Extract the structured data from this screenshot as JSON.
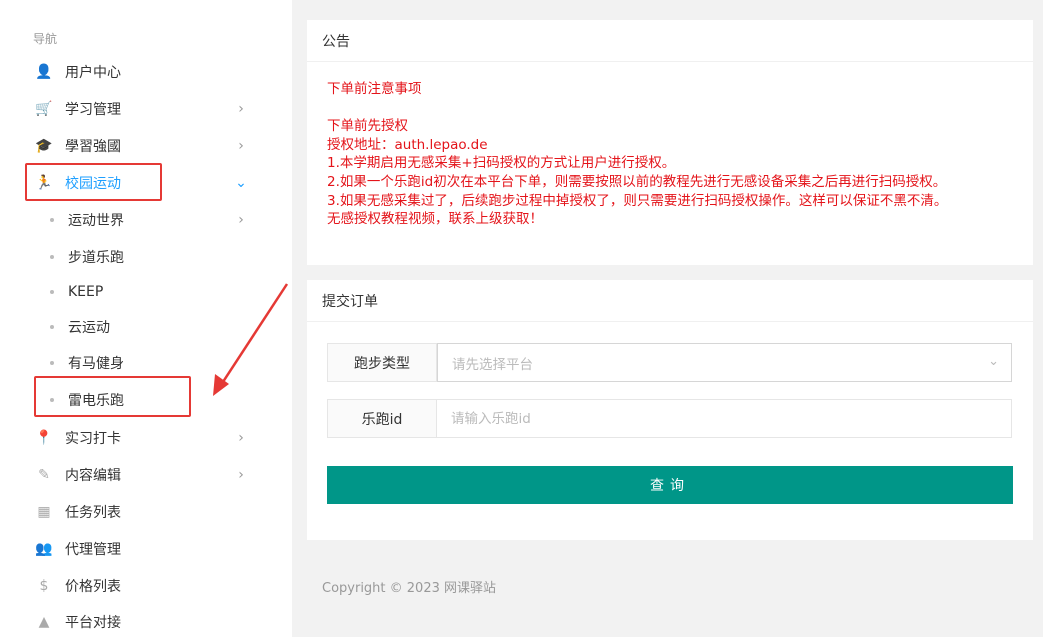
{
  "sidebar": {
    "caption": "导航",
    "items": [
      {
        "label": "用户中心",
        "icon": "user-icon",
        "glyph": "👤",
        "has_children": false
      },
      {
        "label": "学习管理",
        "icon": "cart-icon",
        "glyph": "🛒",
        "has_children": true
      },
      {
        "label": "學習強國",
        "icon": "graduation-cap-icon",
        "glyph": "🎓",
        "has_children": true
      },
      {
        "label": "校园运动",
        "icon": "running-icon",
        "glyph": "🏃",
        "has_children": true,
        "expanded": true,
        "active": true
      }
    ],
    "sub_items": [
      {
        "label": "运动世界",
        "has_children": true
      },
      {
        "label": "步道乐跑",
        "has_children": false
      },
      {
        "label": "KEEP",
        "has_children": false
      },
      {
        "label": "云运动",
        "has_children": false
      },
      {
        "label": "有马健身",
        "has_children": false
      },
      {
        "label": "雷电乐跑",
        "has_children": false
      }
    ],
    "items_after": [
      {
        "label": "实习打卡",
        "icon": "location-pin-icon",
        "glyph": "📍",
        "has_children": true
      },
      {
        "label": "内容编辑",
        "icon": "edit-icon",
        "glyph": "✎",
        "has_children": true
      },
      {
        "label": "任务列表",
        "icon": "building-icon",
        "glyph": "▦",
        "has_children": false
      },
      {
        "label": "代理管理",
        "icon": "users-icon",
        "glyph": "👥",
        "has_children": false
      },
      {
        "label": "价格列表",
        "icon": "dollar-icon",
        "glyph": "$",
        "has_children": false
      },
      {
        "label": "平台对接",
        "icon": "platform-icon",
        "glyph": "▲",
        "has_children": false
      }
    ]
  },
  "notice": {
    "title": "公告",
    "lines": [
      "下单前注意事项",
      "",
      "下单前先授权",
      "授权地址：auth.lepao.de",
      "1.本学期启用无感采集+扫码授权的方式让用户进行授权。",
      "2.如果一个乐跑id初次在本平台下单，则需要按照以前的教程先进行无感设备采集之后再进行扫码授权。",
      "3.如果无感采集过了，后续跑步过程中掉授权了，则只需要进行扫码授权操作。这样可以保证不黑不清。",
      "无感授权教程视频，联系上级获取！"
    ]
  },
  "order": {
    "title": "提交订单",
    "run_type_label": "跑步类型",
    "run_type_placeholder": "请先选择平台",
    "lepao_id_label": "乐跑id",
    "lepao_id_placeholder": "请输入乐跑id",
    "submit_label": "查询"
  },
  "footer": {
    "copyright": "Copyright © 2023 网课驿站"
  },
  "colors": {
    "accent": "#1e9fff",
    "notice_text": "#e4141a",
    "primary_button": "#009688",
    "annotation": "#e53935"
  }
}
